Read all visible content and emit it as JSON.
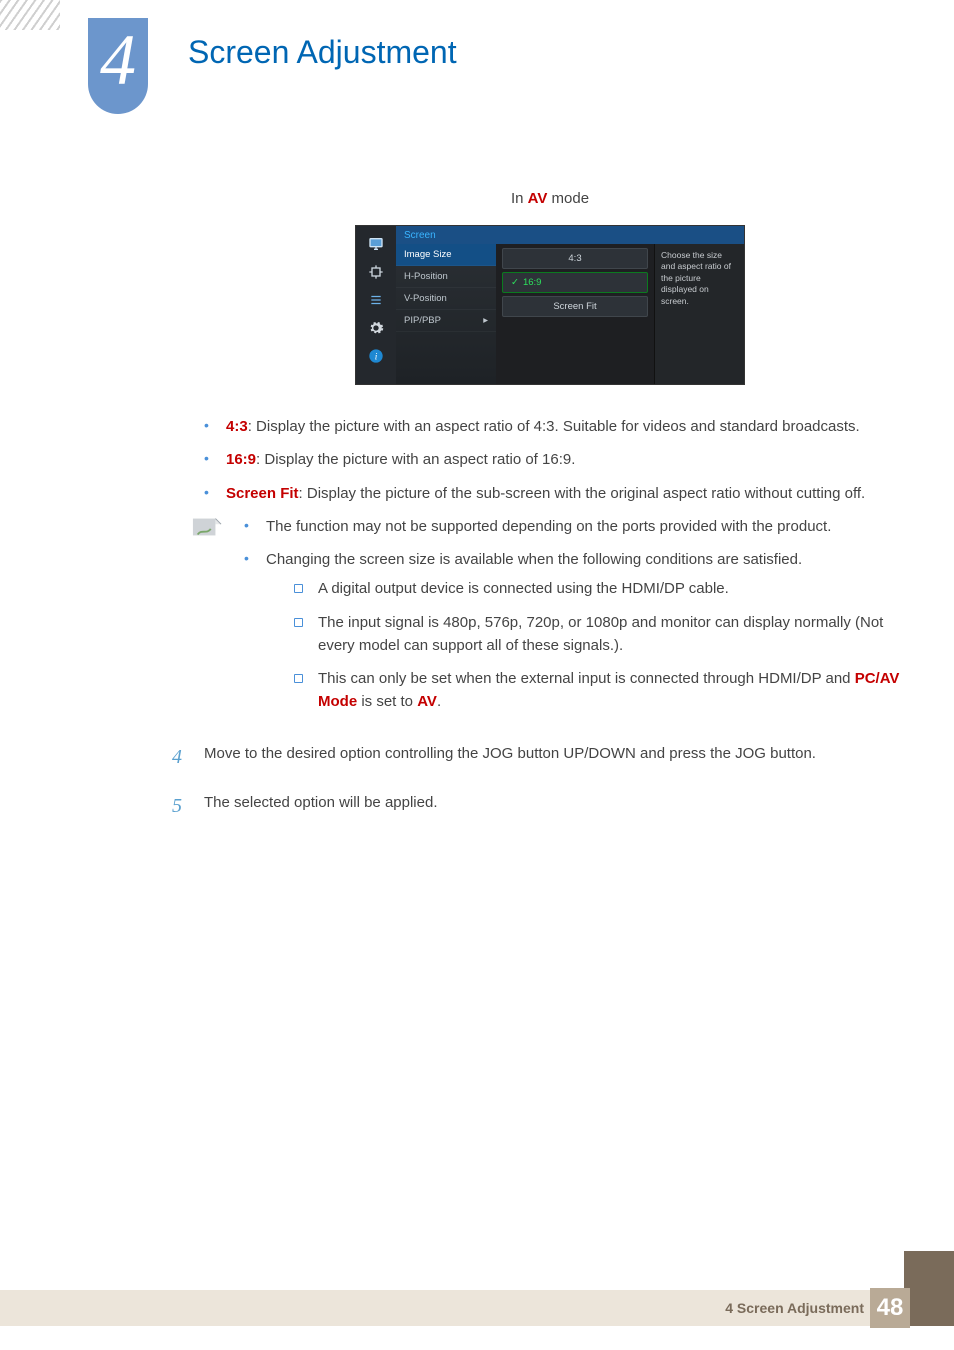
{
  "chapter": {
    "number": "4",
    "title": "Screen Adjustment"
  },
  "mode_line": {
    "prefix": "In ",
    "keyword": "AV",
    "suffix": " mode"
  },
  "osd": {
    "head": "Screen",
    "menu": [
      "Image Size",
      "H-Position",
      "V-Position",
      "PIP/PBP"
    ],
    "options": [
      "4:3",
      "16:9",
      "Screen Fit"
    ],
    "selected_option_index": 1,
    "help": "Choose the size and aspect ratio of the picture displayed on screen."
  },
  "bullets": {
    "b1": {
      "label": "4:3",
      "text": ": Display the picture with an aspect ratio of 4:3. Suitable for videos and standard broadcasts."
    },
    "b2": {
      "label": "16:9",
      "text": ": Display the picture with an aspect ratio of 16:9."
    },
    "b3": {
      "label": "Screen Fit",
      "text": ": Display the picture of the sub-screen with the original aspect ratio without cutting off."
    }
  },
  "notes": {
    "n1": "The function may not be supported depending on the ports provided with the product.",
    "n2": "Changing the screen size is available when the following conditions are satisfied.",
    "sub": {
      "s1": "A digital output device is connected using the HDMI/DP cable.",
      "s2": "The input signal is 480p, 576p, 720p, or 1080p and monitor can display normally (Not every model can support all of these signals.).",
      "s3_a": "This can only be set when the external input is connected through HDMI/DP and ",
      "s3_kw1": "PC/AV Mode",
      "s3_b": " is set to ",
      "s3_kw2": "AV",
      "s3_c": "."
    }
  },
  "steps": {
    "st4": {
      "num": "4",
      "text": "Move to the desired option controlling the JOG button UP/DOWN and press the JOG button."
    },
    "st5": {
      "num": "5",
      "text": "The selected option will be applied."
    }
  },
  "footer": {
    "label": "4 Screen Adjustment",
    "page": "48"
  }
}
